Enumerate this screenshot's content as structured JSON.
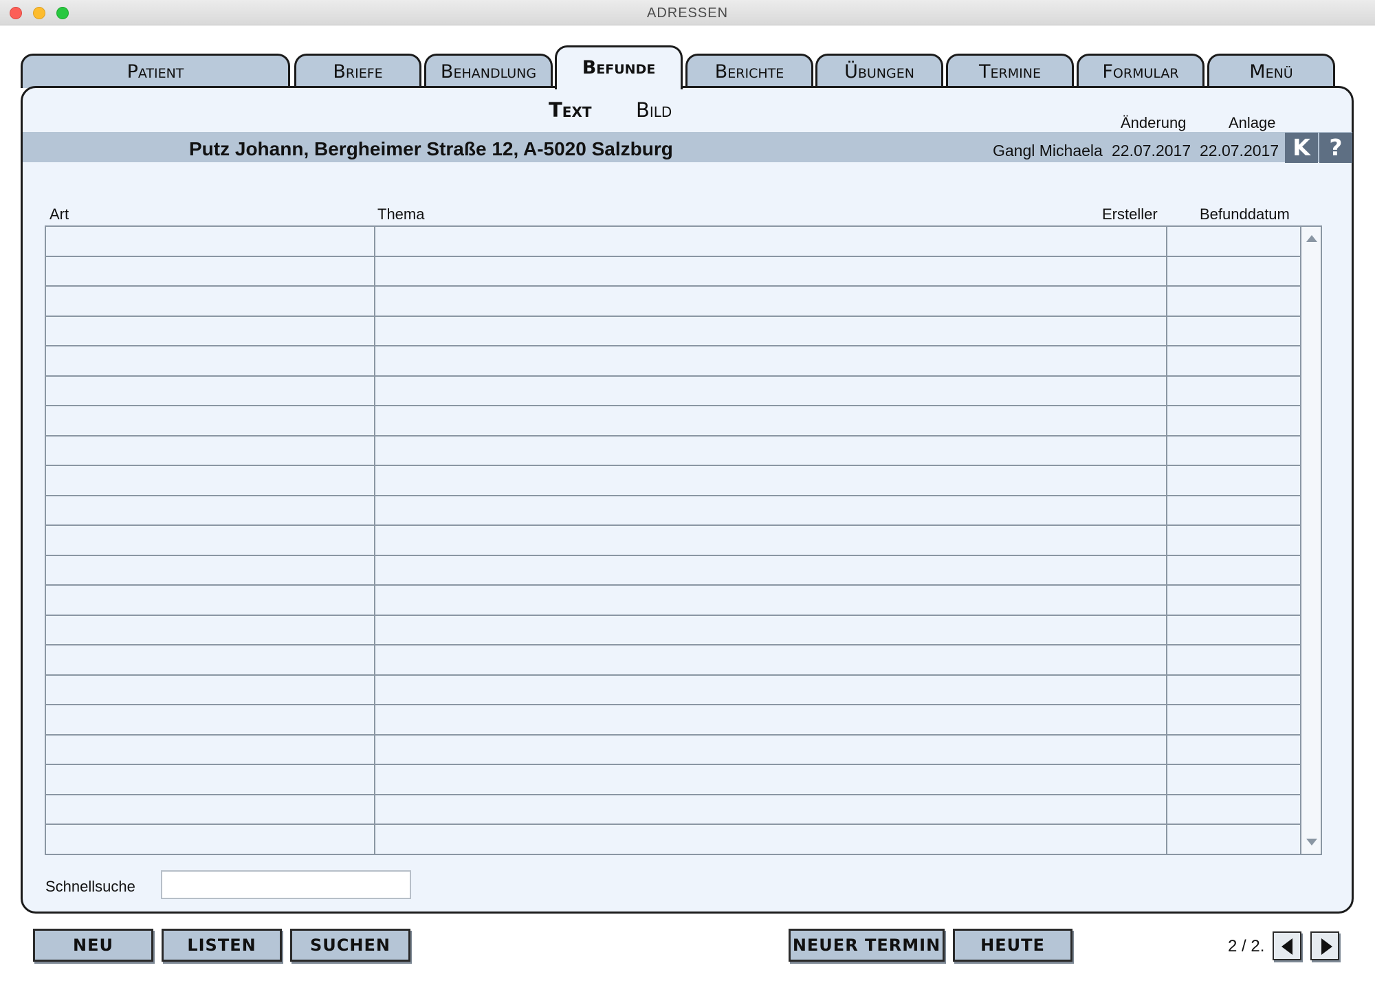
{
  "window": {
    "title": "ADRESSEN"
  },
  "tabs": [
    {
      "label": "Patient"
    },
    {
      "label": "Briefe"
    },
    {
      "label": "Behandlung"
    },
    {
      "label": "Befunde"
    },
    {
      "label": "Berichte"
    },
    {
      "label": "Übungen"
    },
    {
      "label": "Termine"
    },
    {
      "label": "Formular"
    },
    {
      "label": "Menü"
    }
  ],
  "active_tab": "Befunde",
  "subtabs": {
    "text": "Text",
    "bild": "Bild",
    "active": "Text"
  },
  "labels": {
    "aenderung": "Änderung",
    "anlage": "Anlage"
  },
  "patient": {
    "header": "Putz Johann, Bergheimer Straße 12, A-5020 Salzburg",
    "user": "Gangl Michaela",
    "aenderung_date": "22.07.2017",
    "anlage_date": "22.07.2017"
  },
  "icon_buttons": {
    "k": "K",
    "help": "?"
  },
  "table": {
    "columns": [
      "Art",
      "Thema",
      "Ersteller",
      "Befunddatum"
    ],
    "rows": []
  },
  "search": {
    "label": "Schnellsuche",
    "value": "",
    "placeholder": ""
  },
  "buttons": {
    "neu": "NEU",
    "listen": "LISTEN",
    "suchen": "SUCHEN",
    "neuer_termin": "NEUER TERMIN",
    "heute": "HEUTE"
  },
  "pager": {
    "text": "2 / 2."
  },
  "icons": {
    "scroll_up": "chevron-up-icon",
    "scroll_down": "chevron-down-icon",
    "prev": "triangle-left-icon",
    "next": "triangle-right-icon"
  }
}
